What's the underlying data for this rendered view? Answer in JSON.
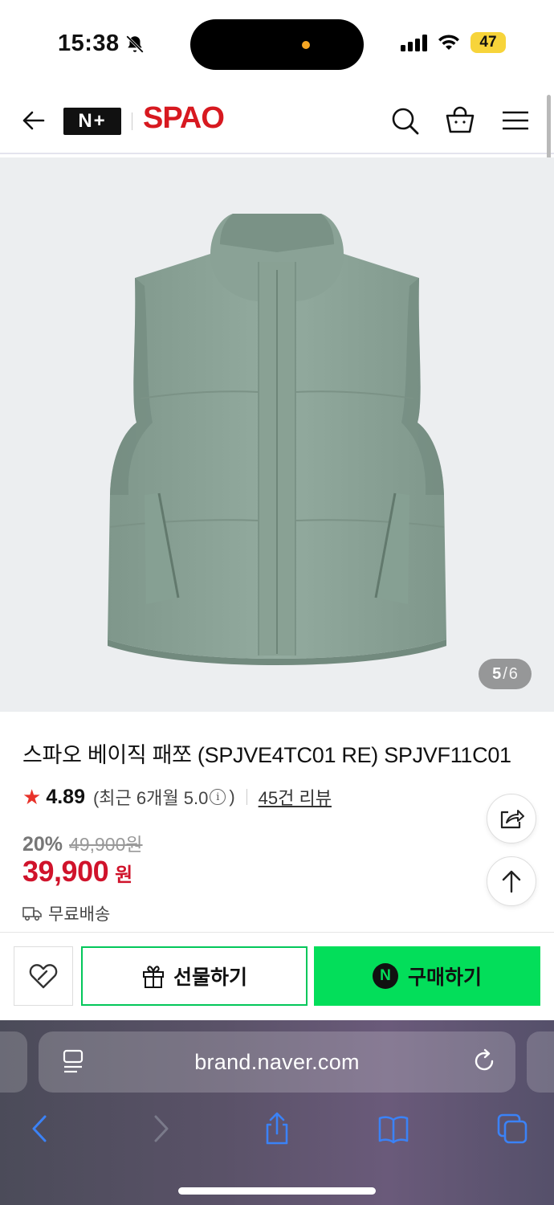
{
  "status_bar": {
    "time": "15:38",
    "battery": "47"
  },
  "header": {
    "brand_badge": "N+",
    "brand_logo": "SPAO",
    "icons": [
      "back-arrow-icon",
      "search-icon",
      "shopping-bag-icon",
      "menu-icon"
    ]
  },
  "gallery": {
    "current": "5",
    "total": "6",
    "separator": "/"
  },
  "product": {
    "title": "스파오 베이직 패쪼 (SPJVE4TC01 RE) SPJVF11C01",
    "rating": "4.89",
    "rating_sub_prefix": "(최근 6개월 5.0",
    "rating_sub_suffix": ")",
    "review_count": "45건 리뷰",
    "discount_rate": "20%",
    "original_price": "49,900원",
    "price": "39,900",
    "price_unit": "원",
    "shipping": "무료배송"
  },
  "actions": {
    "gift_label": "선물하기",
    "buy_label": "구매하기",
    "npay_mark": "N"
  },
  "browser": {
    "url": "brand.naver.com"
  },
  "colors": {
    "price_red": "#d0132b",
    "naver_green": "#03de5a",
    "spao_red": "#d71920",
    "vest_green": "#8fa79a"
  }
}
